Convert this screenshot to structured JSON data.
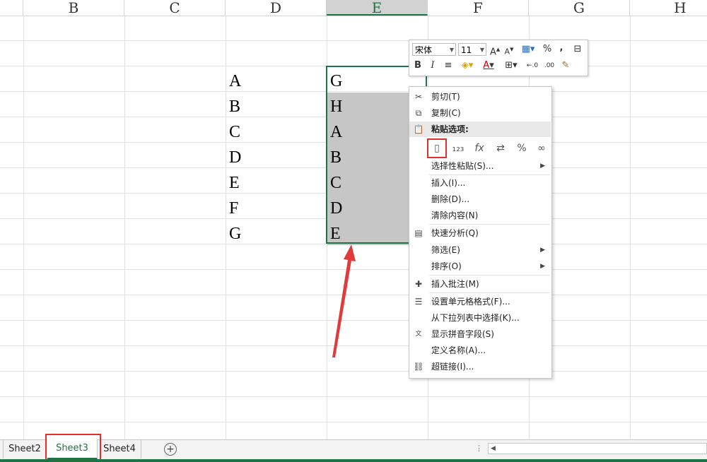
{
  "columns": [
    "B",
    "C",
    "D",
    "E",
    "F",
    "G",
    "H"
  ],
  "selected_column": "E",
  "column_d_values": [
    "A",
    "B",
    "C",
    "D",
    "E",
    "F",
    "G"
  ],
  "column_e_values": [
    "G",
    "H",
    "A",
    "B",
    "C",
    "D",
    "E"
  ],
  "mini_toolbar": {
    "font_name": "宋体",
    "font_size": "11",
    "bold": "B",
    "italic": "I",
    "percent": "%",
    "comma": ","
  },
  "context_menu": {
    "cut": "剪切(T)",
    "copy": "复制(C)",
    "paste_options": "粘贴选项:",
    "paste_special": "选择性粘贴(S)...",
    "insert": "插入(I)...",
    "delete": "删除(D)...",
    "clear_contents": "清除内容(N)",
    "quick_analysis": "快速分析(Q)",
    "filter": "筛选(E)",
    "sort": "排序(O)",
    "insert_comment": "插入批注(M)",
    "format_cells": "设置单元格格式(F)...",
    "pick_from_list": "从下拉列表中选择(K)...",
    "phonetic": "显示拼音字段(S)",
    "define_name": "定义名称(A)...",
    "hyperlink": "超链接(I)..."
  },
  "sheets": [
    "Sheet2",
    "Sheet3",
    "Sheet4"
  ],
  "active_sheet": "Sheet3",
  "colors": {
    "accent": "#217346",
    "highlight": "#e03030",
    "selection_fill": "#c6c6c6"
  }
}
